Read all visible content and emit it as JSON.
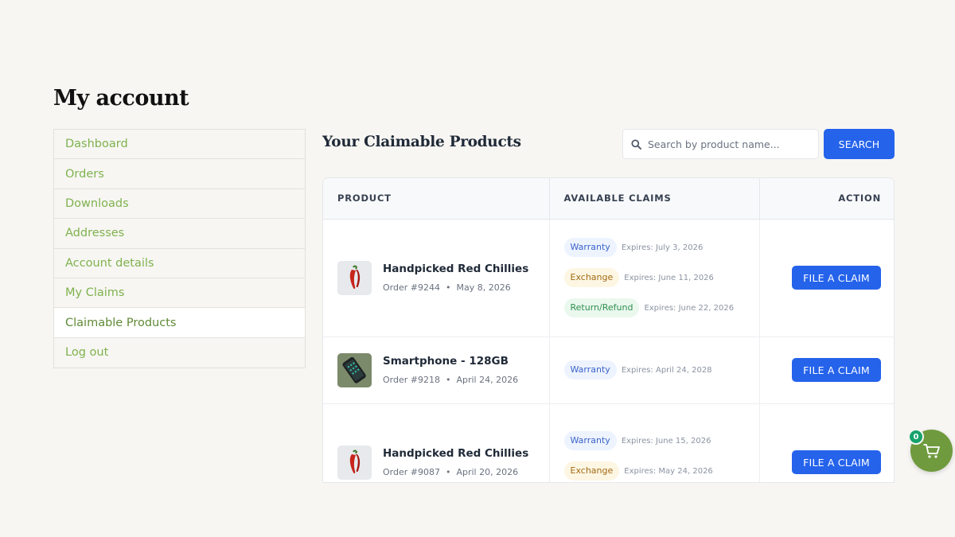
{
  "page": {
    "title": "My account"
  },
  "sidebar": {
    "items": [
      {
        "label": "Dashboard"
      },
      {
        "label": "Orders"
      },
      {
        "label": "Downloads"
      },
      {
        "label": "Addresses"
      },
      {
        "label": "Account details"
      },
      {
        "label": "My Claims"
      },
      {
        "label": "Claimable Products",
        "active": true
      },
      {
        "label": "Log out"
      }
    ]
  },
  "main": {
    "title": "Your Claimable Products",
    "search": {
      "placeholder": "Search by product name...",
      "value": "",
      "button_label": "SEARCH"
    },
    "table": {
      "headers": [
        "PRODUCT",
        "AVAILABLE CLAIMS",
        "ACTION"
      ],
      "rows": [
        {
          "product": "Handpicked Red Chillies",
          "order": "Order #9244",
          "date": "May 8, 2026",
          "claims": [
            {
              "type": "Warranty",
              "expires": "Expires: July 3, 2026"
            },
            {
              "type": "Exchange",
              "expires": "Expires: June 11, 2026"
            },
            {
              "type": "Return/Refund",
              "expires": "Expires: June 22, 2026"
            }
          ],
          "action_label": "FILE A CLAIM"
        },
        {
          "product": "Smartphone - 128GB",
          "order": "Order #9218",
          "date": "April 24, 2026",
          "claims": [
            {
              "type": "Warranty",
              "expires": "Expires: April 24, 2028"
            }
          ],
          "action_label": "FILE A CLAIM"
        },
        {
          "product": "Handpicked Red Chillies",
          "order": "Order #9087",
          "date": "April 20, 2026",
          "claims": [
            {
              "type": "Warranty",
              "expires": "Expires: June 15, 2026"
            },
            {
              "type": "Exchange",
              "expires": "Expires: May 24, 2026"
            }
          ],
          "action_label": "FILE A CLAIM"
        }
      ]
    }
  },
  "cart": {
    "count": "0"
  },
  "colors": {
    "accent": "#2563eb",
    "link": "#7fb24d",
    "cart": "#6f9a3d",
    "badge": "#15a36b"
  }
}
